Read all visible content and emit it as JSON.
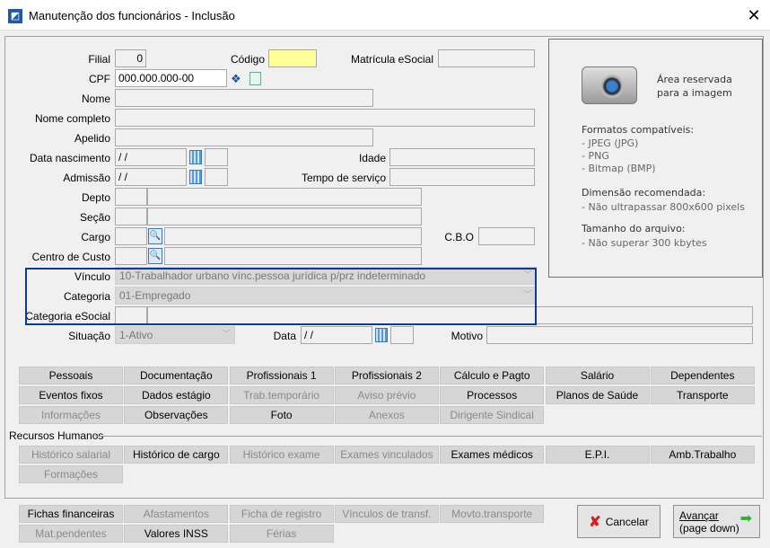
{
  "window": {
    "title": "Manutenção dos funcionários - Inclusão",
    "close": "✕"
  },
  "form": {
    "filial_label": "Filial",
    "filial": "0",
    "codigo_label": "Código",
    "codigo": "",
    "matricula_label": "Matrícula eSocial",
    "matricula": "",
    "cpf_label": "CPF",
    "cpf": "000.000.000-00",
    "nome_label": "Nome",
    "nome_completo_label": "Nome completo",
    "apelido_label": "Apelido",
    "data_nasc_label": "Data nascimento",
    "data_nasc": "/ /",
    "idade_label": "Idade",
    "admissao_label": "Admissão",
    "admissao": "/ /",
    "tempo_label": "Tempo de serviço",
    "depto_label": "Depto",
    "secao_label": "Seção",
    "cargo_label": "Cargo",
    "cbo_label": "C.B.O",
    "centro_label": "Centro de Custo",
    "vinculo_label": "Vínculo",
    "vinculo": "10-Trabalhador urbano vínc.pessoa jurídica p/prz indeterminado",
    "categoria_label": "Categoria",
    "categoria": "01-Empregado",
    "cat_esocial_label": "Categoria eSocial",
    "situacao_label": "Situação",
    "situacao": "1-Ativo",
    "data_label": "Data",
    "data": "/ /",
    "motivo_label": "Motivo"
  },
  "image_panel": {
    "reserved": "Área reservada",
    "reserved2": "para a imagem",
    "formats_title": "Formatos compatíveis:",
    "formats": [
      "- JPEG (JPG)",
      "- PNG",
      "- Bitmap (BMP)"
    ],
    "dim_title": "Dimensão recomendada:",
    "dim": "- Não ultrapassar 800x600 pixels",
    "size_title": "Tamanho do arquivo:",
    "size": "- Não superar 300 kbytes"
  },
  "buttons": [
    {
      "label": "Pessoais",
      "enabled": true
    },
    {
      "label": "Documentação",
      "enabled": true
    },
    {
      "label": "Profissionais 1",
      "enabled": true
    },
    {
      "label": "Profissionais 2",
      "enabled": true
    },
    {
      "label": "Cálculo e Pagto",
      "enabled": true
    },
    {
      "label": "Salário",
      "enabled": true
    },
    {
      "label": "Dependentes",
      "enabled": true
    },
    {
      "label": "Eventos fixos",
      "enabled": true
    },
    {
      "label": "Dados estágio",
      "enabled": true
    },
    {
      "label": "Trab.temporário",
      "enabled": false
    },
    {
      "label": "Aviso prévio",
      "enabled": false
    },
    {
      "label": "Processos",
      "enabled": true
    },
    {
      "label": "Planos de Saúde",
      "enabled": true
    },
    {
      "label": "Transporte",
      "enabled": true
    },
    {
      "label": "Informações",
      "enabled": false
    },
    {
      "label": "Observações",
      "enabled": true
    },
    {
      "label": "Foto",
      "enabled": true
    },
    {
      "label": "Anexos",
      "enabled": false
    },
    {
      "label": "Dirigente Sindical",
      "enabled": false
    }
  ],
  "rh": {
    "title": "Recursos Humanos",
    "buttons": [
      {
        "label": "Histórico salarial",
        "enabled": false
      },
      {
        "label": "Histórico de cargo",
        "enabled": true
      },
      {
        "label": "Histórico exame",
        "enabled": false
      },
      {
        "label": "Exames vinculados",
        "enabled": false
      },
      {
        "label": "Exames médicos",
        "enabled": true
      },
      {
        "label": "E.P.I.",
        "enabled": true
      },
      {
        "label": "Amb.Trabalho",
        "enabled": true
      },
      {
        "label": "Formações",
        "enabled": false
      }
    ]
  },
  "bottom": {
    "buttons": [
      {
        "label": "Fichas financeiras",
        "enabled": true
      },
      {
        "label": "Afastamentos",
        "enabled": false
      },
      {
        "label": "Ficha de registro",
        "enabled": false
      },
      {
        "label": "Vínculos de transf.",
        "enabled": false
      },
      {
        "label": "Movto.transporte",
        "enabled": false
      },
      {
        "label": "Mat.pendentes",
        "enabled": false
      },
      {
        "label": "Valores INSS",
        "enabled": true
      },
      {
        "label": "Férias",
        "enabled": false
      }
    ],
    "cancel": "Cancelar",
    "next1": "Avançar",
    "next2": "(page down)"
  }
}
